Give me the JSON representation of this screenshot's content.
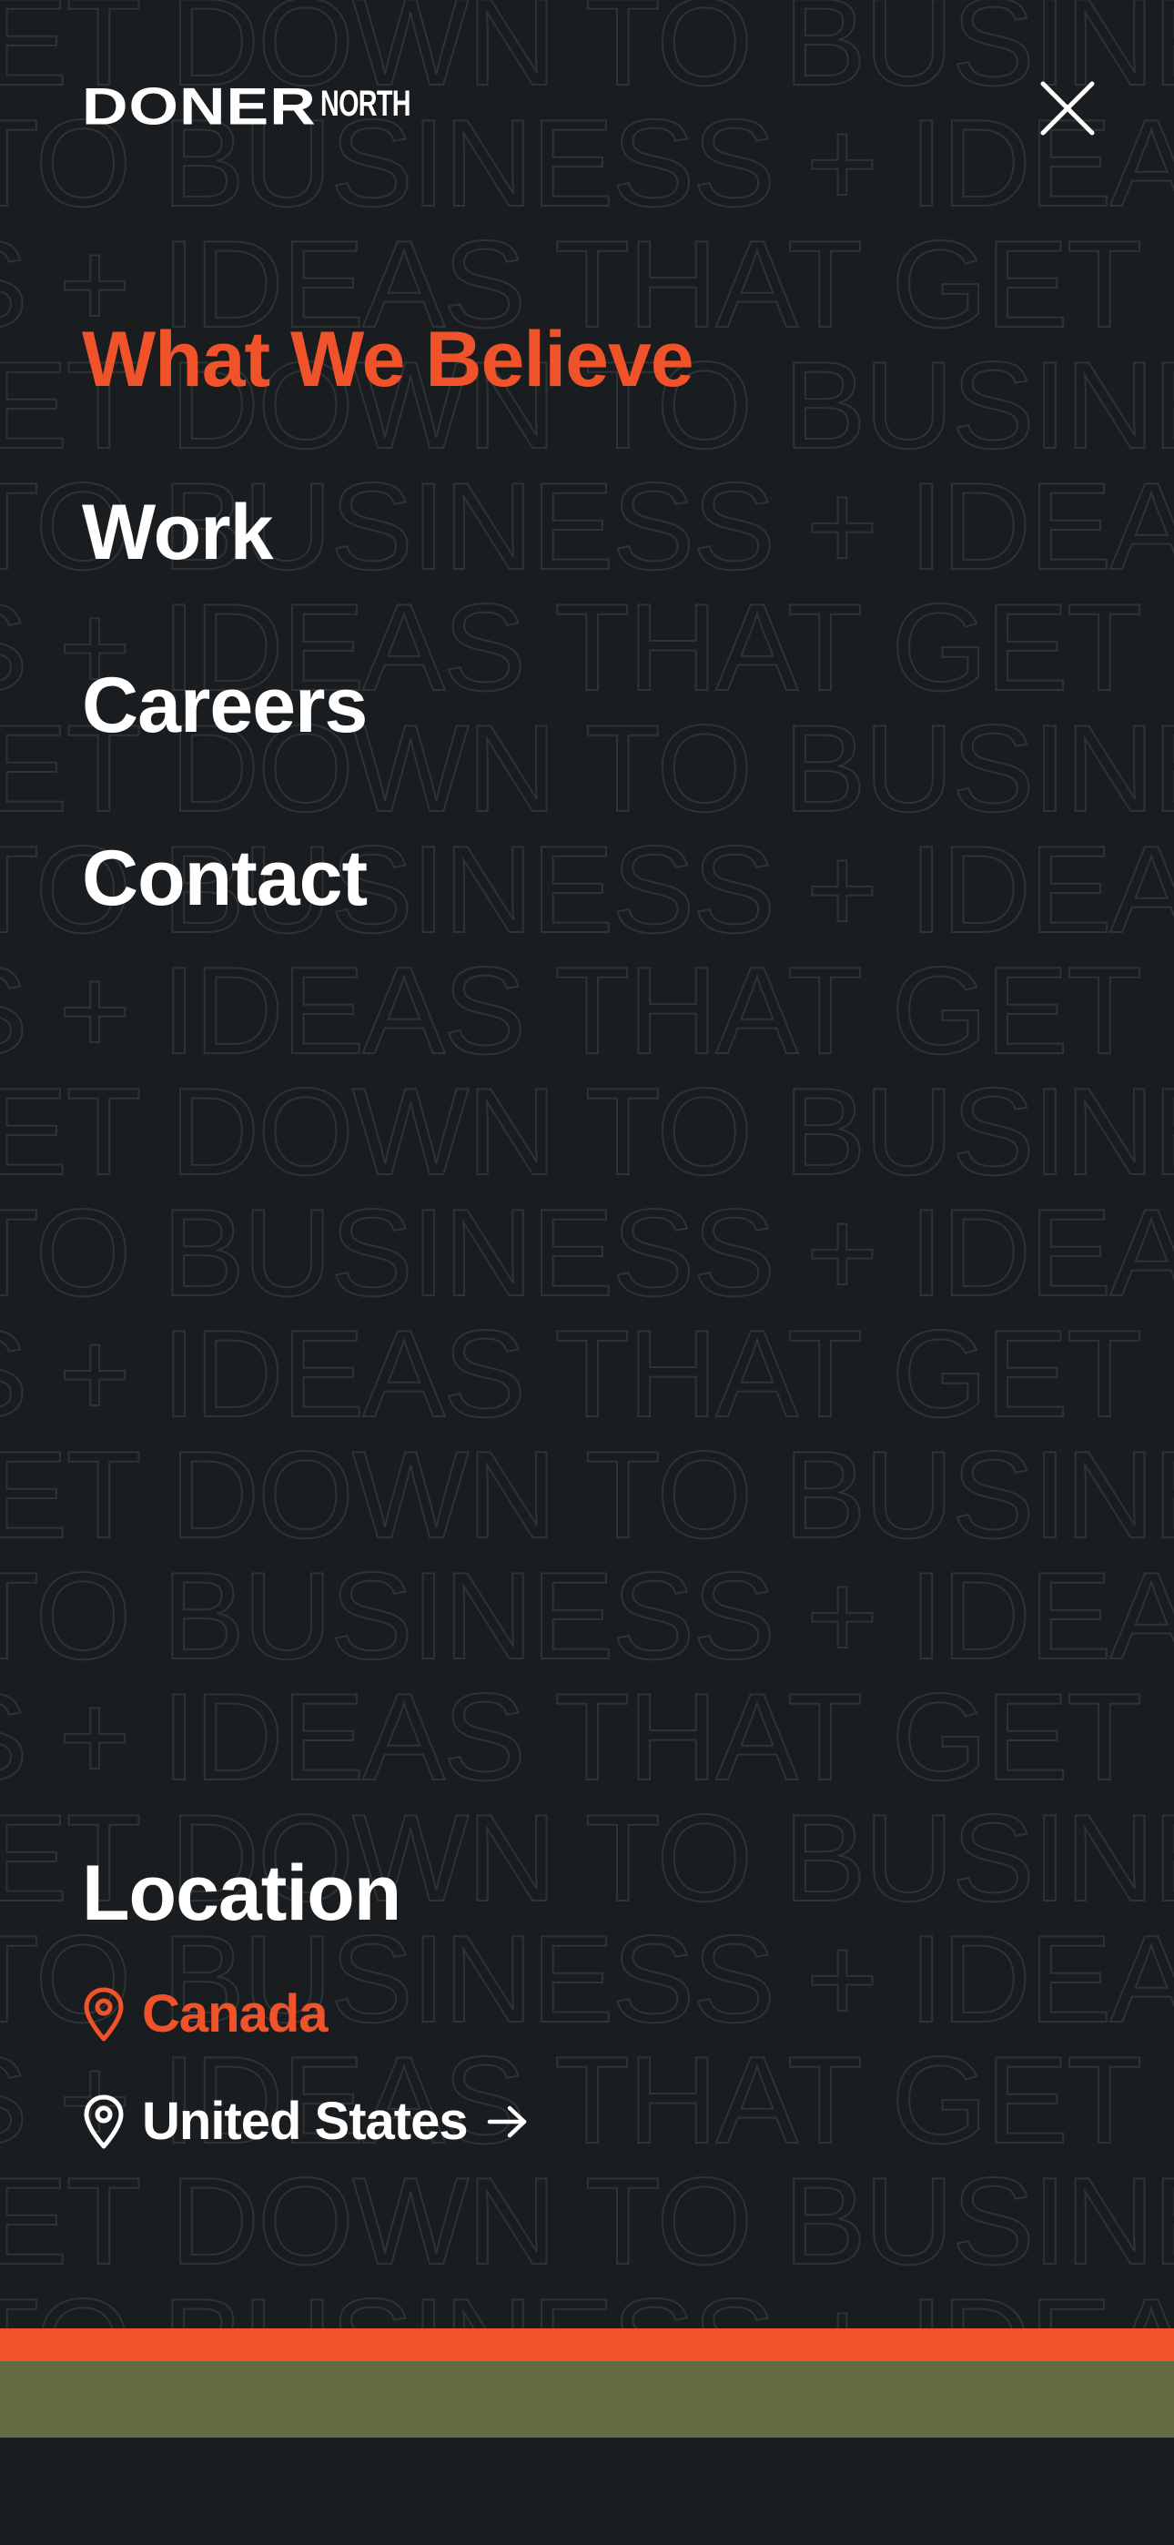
{
  "brand": {
    "logo_main": "DONER",
    "logo_sub": "NORTH",
    "accent_color": "#f0532a",
    "olive_color": "#636b43",
    "background_color": "#1a1d1f"
  },
  "background_pattern": {
    "lines": [
      "GET DOWN TO BUSINESS + IDEAS THAT GET DOWN TO BUSINESS",
      "TO BUSINESS + IDEAS THAT GET DOWN TO BUSINESS + IDEAS",
      "S + IDEAS THAT GET DOWN TO BUSINESS + IDEAS THAT GET DOWN"
    ]
  },
  "header": {
    "close_icon": "close-icon"
  },
  "menu": {
    "items": [
      {
        "label": "What We Believe",
        "active": true
      },
      {
        "label": "Work",
        "active": false
      },
      {
        "label": "Careers",
        "active": false
      },
      {
        "label": "Contact",
        "active": false
      }
    ]
  },
  "location": {
    "title": "Location",
    "options": [
      {
        "label": "Canada",
        "icon": "map-pin-icon",
        "selected": true
      },
      {
        "label": "United States",
        "icon": "map-pin-icon",
        "selected": false,
        "trailing_icon": "arrow-right-icon"
      }
    ]
  }
}
